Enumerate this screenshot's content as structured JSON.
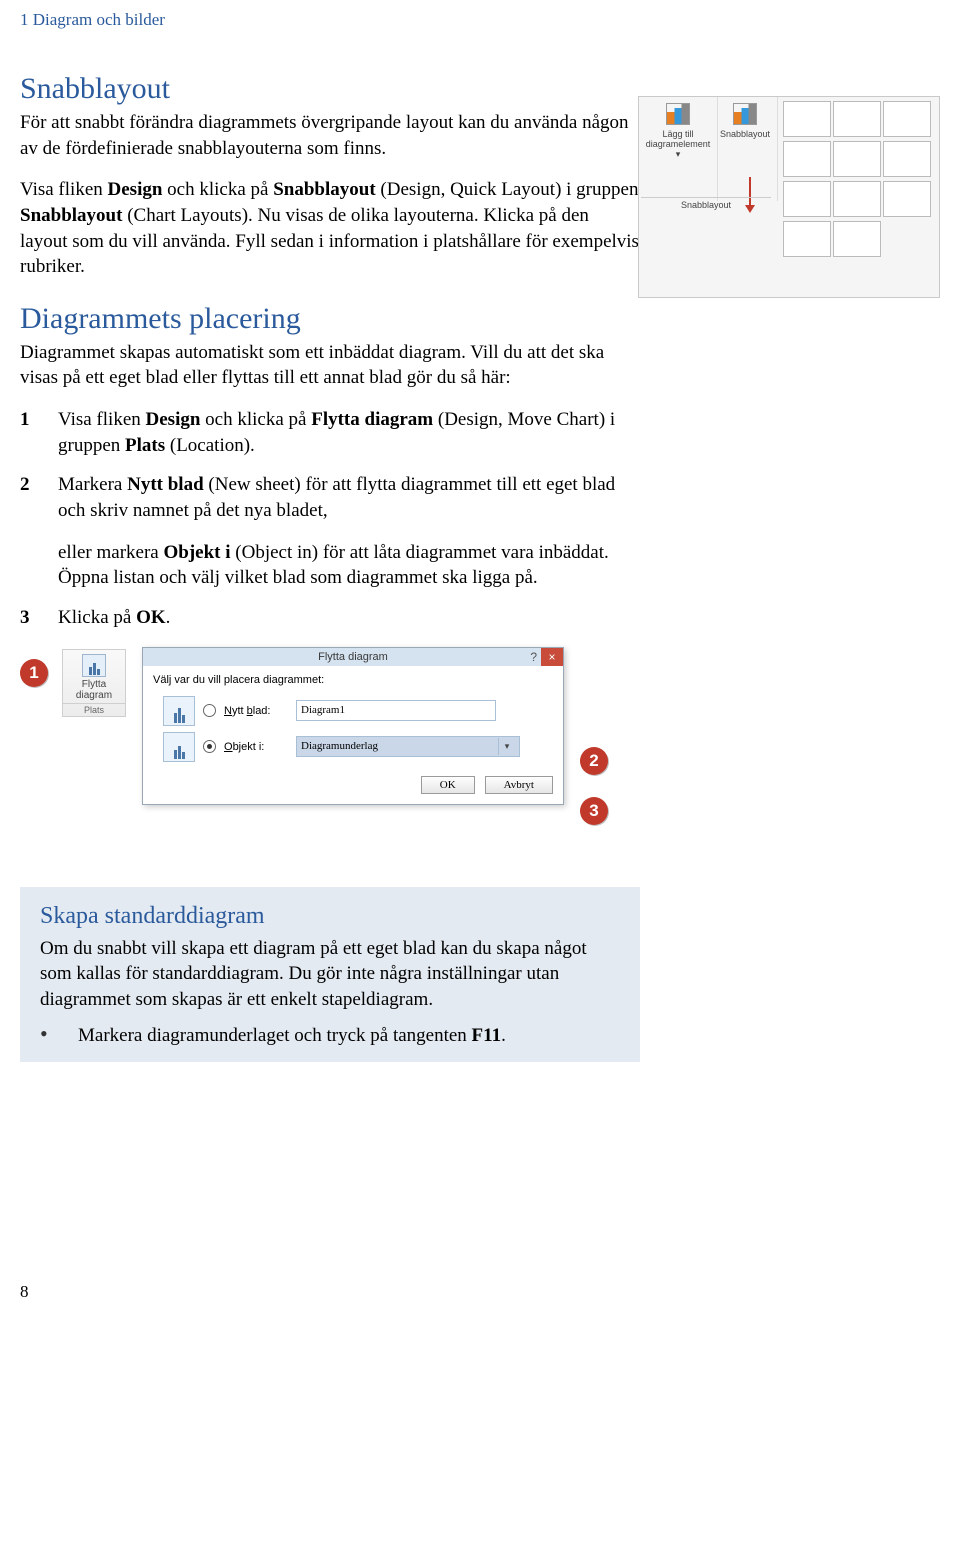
{
  "header": "1  Diagram och bilder",
  "section1": {
    "title": "Snabblayout",
    "p1a": "För att snabbt förändra diagrammets övergripande layout kan du använda någon av de fördefinierade snabblayouterna som finns.",
    "p2_pre": "Visa fliken ",
    "p2_b1": "Design",
    "p2_mid1": " och klicka på ",
    "p2_b2": "Snabblayout",
    "p2_mid2": " (Design, Quick Layout) i gruppen ",
    "p2_b3": "Snabblayout",
    "p2_tail": " (Chart Layouts). Nu visas de olika layouterna. Klicka på den layout som du vill använda. Fyll sedan i information i platshållare för exempelvis rubriker."
  },
  "ribbon": {
    "add_label": "Lägg till diagramelement ▾",
    "quick_label": "Snabblayout",
    "group_caption": "Snabblayout"
  },
  "section2": {
    "title": "Diagrammets placering",
    "intro": "Diagrammet skapas automatiskt som ett inbäddat diagram. Vill du att det ska visas på ett eget blad eller flyttas till ett annat blad gör du så här:",
    "steps": [
      {
        "num": "1",
        "pre": "Visa fliken ",
        "b1": "Design",
        "mid1": " och klicka på ",
        "b2": "Flytta diagram",
        "mid2": " (Design, Move Chart) i gruppen ",
        "b3": "Plats",
        "tail": " (Location)."
      },
      {
        "num": "2",
        "pre": "Markera ",
        "b1": "Nytt blad",
        "tail": " (New sheet) för att flytta diagrammet till ett eget blad och skriv namnet på det nya bladet,"
      }
    ],
    "sub_pre": "eller markera ",
    "sub_b": "Objekt i",
    "sub_tail": " (Object in) för att låta diagrammet vara inbäddat. Öppna listan och välj vilket blad som diagrammet ska ligga på.",
    "step3_num": "3",
    "step3_pre": "Klicka på ",
    "step3_b": "OK",
    "step3_dot": "."
  },
  "flytta_button": {
    "line1": "Flytta",
    "line2": "diagram",
    "group": "Plats"
  },
  "dialog": {
    "title": "Flytta diagram",
    "lead": "Välj var du vill placera diagrammet:",
    "opt1_label": "Nytt blad:",
    "opt1_value": "Diagram1",
    "opt2_label": "Objekt i:",
    "opt2_value": "Diagramunderlag",
    "ok": "OK",
    "cancel": "Avbryt"
  },
  "callouts": {
    "c1": "1",
    "c2": "2",
    "c3": "3"
  },
  "tip": {
    "title": "Skapa standarddiagram",
    "p1": "Om du snabbt vill skapa ett diagram på ett eget blad kan du skapa något som kallas för standarddiagram. Du gör inte några inställningar utan diagrammet som skapas är ett enkelt stapeldiagram.",
    "bullet_pre": "Markera diagramunderlaget och tryck på tangenten ",
    "bullet_b": "F11",
    "bullet_dot": "."
  },
  "pagenum": "8"
}
